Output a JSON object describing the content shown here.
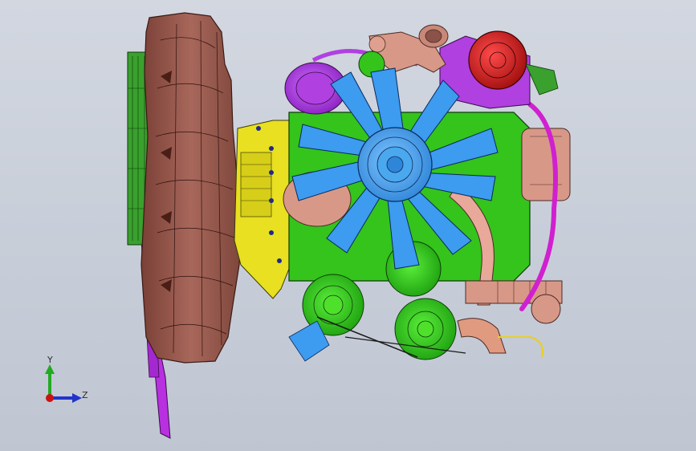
{
  "viewport": {
    "background": "#c9cfda"
  },
  "triad": {
    "y_label": "Y",
    "z_label": "Z",
    "y_color": "#22aa22",
    "z_color": "#2233cc",
    "origin_color": "#cc1111"
  },
  "model": {
    "description_icon": "engine-assembly-icon",
    "colors": {
      "bellhousing": "#9a5a50",
      "flywheel_cover": "#3aa02e",
      "block": "#34c41c",
      "fan_blade": "#3d9bf0",
      "fan_hub": "#4aa8ee",
      "bracket": "#e8e020",
      "turbo": "#c41010",
      "intake": "#b040e0",
      "pipe": "#d89888",
      "hose": "#d020d0"
    }
  }
}
